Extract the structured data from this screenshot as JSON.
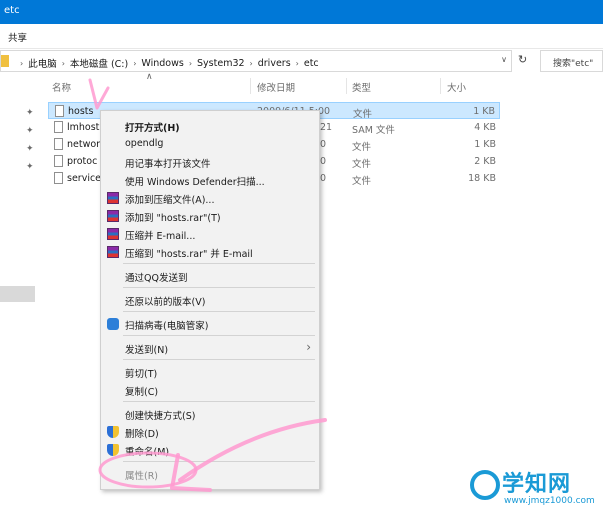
{
  "window": {
    "title": "etc"
  },
  "ribbon": {
    "tab": "共享"
  },
  "address": {
    "crumbs": [
      "此电脑",
      "本地磁盘 (C:)",
      "Windows",
      "System32",
      "drivers",
      "etc"
    ],
    "search_placeholder": "搜索\"etc\""
  },
  "columns": {
    "name": "名称",
    "date": "修改日期",
    "type": "类型",
    "size": "大小"
  },
  "files": [
    {
      "name": "hosts",
      "date": "2009/6/11 5:00",
      "type": "文件",
      "size": "1 KB",
      "selected": true
    },
    {
      "name": "lmhost",
      "date": "21",
      "type": "SAM 文件",
      "size": "4 KB"
    },
    {
      "name": "networ",
      "date": "0",
      "type": "文件",
      "size": "1 KB"
    },
    {
      "name": "protoc",
      "date": "0",
      "type": "文件",
      "size": "2 KB"
    },
    {
      "name": "service",
      "date": "0",
      "type": "文件",
      "size": "18 KB"
    }
  ],
  "context_menu": {
    "open_with": "打开方式(H)",
    "opendlg": "opendlg",
    "open_notepad": "用记事本打开该文件",
    "defender": "使用 Windows Defender扫描...",
    "add_archive": "添加到压缩文件(A)...",
    "add_rar": "添加到 \"hosts.rar\"(T)",
    "compress_email": "压缩并 E-mail...",
    "compress_rar_email": "压缩到 \"hosts.rar\" 并 E-mail",
    "send_qq": "通过QQ发送到",
    "restore": "还原以前的版本(V)",
    "scan_virus": "扫描病毒(电脑管家)",
    "send_to": "发送到(N)",
    "cut": "剪切(T)",
    "copy": "复制(C)",
    "shortcut": "创建快捷方式(S)",
    "delete": "删除(D)",
    "rename": "重命名(M)",
    "properties": "属性(R)"
  },
  "watermark": {
    "brand": "学知网",
    "url": "www.jmqz1000.com"
  },
  "colors": {
    "titlebar": "#0078d7",
    "selection": "#cce8ff",
    "annotation": "#ff9ad0"
  }
}
